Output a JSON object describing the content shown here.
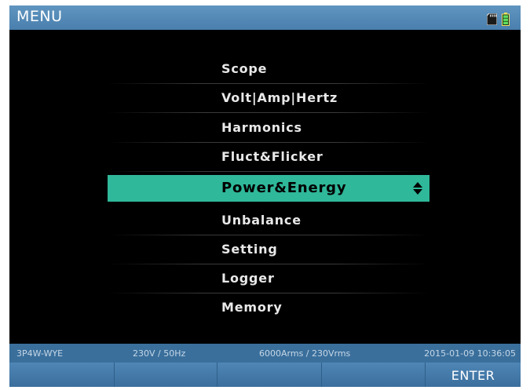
{
  "header": {
    "title": "MENU",
    "sd_icon": "sd-card-icon",
    "battery_icon": "battery-full-icon",
    "accent_color": "#4a7fae"
  },
  "menu": {
    "selected_color": "#2fb89a",
    "items": [
      {
        "label": "Scope"
      },
      {
        "label": "Volt|Amp|Hertz"
      },
      {
        "label": "Harmonics"
      },
      {
        "label": "Fluct&Flicker"
      },
      {
        "label": "Power&Energy",
        "selected": true,
        "icon": "up-down-arrows-icon"
      },
      {
        "label": "Unbalance"
      },
      {
        "label": "Setting"
      },
      {
        "label": "Logger"
      },
      {
        "label": "Memory"
      }
    ]
  },
  "status": {
    "wiring": "3P4W-WYE",
    "nominal": "230V / 50Hz",
    "range": "6000Arms / 230Vrms",
    "datetime": "2015-01-09 10:36:05"
  },
  "softkeys": [
    "",
    "",
    "",
    "",
    "ENTER"
  ]
}
